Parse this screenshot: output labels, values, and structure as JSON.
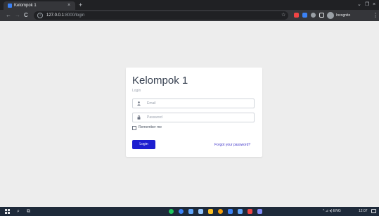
{
  "browser": {
    "tab_title": "Kelompok 1",
    "tab_close": "×",
    "new_tab": "+",
    "window_minimize": "⌄",
    "window_restore": "❐",
    "window_close": "×",
    "back": "←",
    "forward": "→",
    "reload": "C",
    "url_host": "127.0.0.1",
    "url_path": ":8000/login",
    "bookmark_star": "☆",
    "profile_label": "Incognito",
    "menu": "⋮"
  },
  "login": {
    "title": "Kelompok 1",
    "subtitle": "Login",
    "email_placeholder": "Email",
    "password_placeholder": "Password",
    "remember_label": "Remember me",
    "login_button": "Login",
    "forgot_link": "Forgot your password?"
  },
  "taskbar": {
    "search": "⌕",
    "task_view": "⧉",
    "tray": "^ ⊿ ◂) ENG",
    "time": "12:07"
  },
  "colors": {
    "primary": "#1d1ed0",
    "link": "#4338ca",
    "page_bg": "#ededed",
    "chrome_dark": "#202124",
    "taskbar": "#1e2a3a"
  },
  "icons": {
    "email_field": "user-icon",
    "password_field": "lock-icon"
  }
}
